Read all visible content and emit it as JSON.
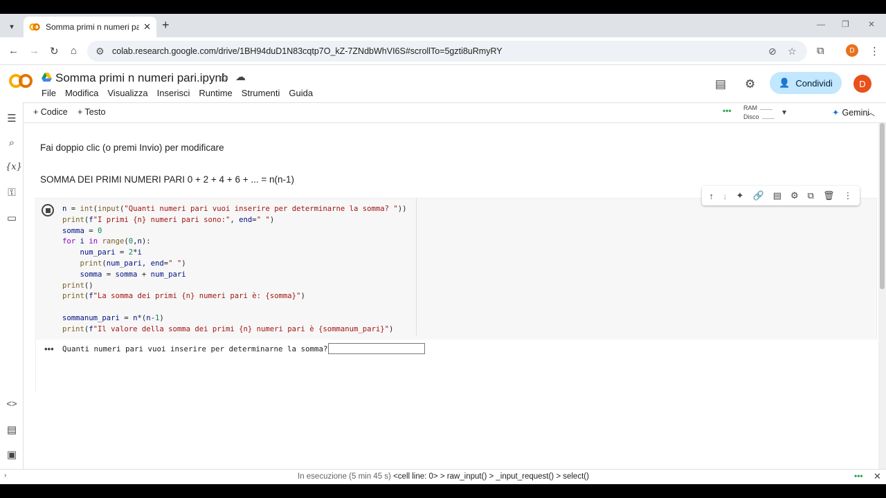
{
  "browser": {
    "tab_title": "Somma primi n numeri pari.ipynb",
    "new_tab": "+",
    "url": "colab.research.google.com/drive/1BH94duD1N83cqtp7O_kZ-7ZNdbWhVI6S#scrollTo=5gzti8uRmyRY",
    "profile_initial": "D"
  },
  "colab": {
    "logo": "CO",
    "notebook_title": "Somma primi n numeri pari.ipynb",
    "menu": [
      "File",
      "Modifica",
      "Visualizza",
      "Inserisci",
      "Runtime",
      "Strumenti",
      "Guida"
    ],
    "share_label": "Condividi",
    "avatar_initial": "D"
  },
  "toolbar": {
    "code_label": "Codice",
    "text_label": "Testo",
    "ram_label": "RAM",
    "disk_label": "Disco",
    "gemini_label": "Gemini"
  },
  "markdown": {
    "line1": "Fai doppio clic (o premi Invio) per modificare",
    "line2": "SOMMA DEI PRIMI NUMERI PARI 0 + 2 + 4 + 6 + ... = n(n-1)"
  },
  "code_lines": [
    "n = int(input(\"Quanti numeri pari vuoi inserire per determinarne la somma? \"))",
    "print(f\"I primi {n} numeri pari sono:\", end=\" \")",
    "somma = 0",
    "for i in range(0,n):",
    "    num_pari = 2*i",
    "    print(num_pari, end=\" \")",
    "    somma = somma + num_pari",
    "print()",
    "print(f\"La somma dei primi {n} numeri pari è: {somma}\")",
    "",
    "sommanum_pari = n*(n-1)",
    "print(f\"Il valore della somma dei primi {n} numeri pari è {sommanum_pari}\")"
  ],
  "output": {
    "dots": "•••",
    "prompt": "Quanti numeri pari vuoi inserire per determinarne la somma?",
    "input_value": ""
  },
  "status": {
    "running": "In esecuzione (5 min 45 s)",
    "trace": "<cell line: 0> > raw_input() > _input_request() > select()"
  },
  "colors": {
    "accent": "#1a73e8",
    "share_bg": "#c2e7ff",
    "avatar_bg": "#e8501c",
    "logo_orange": "#f9ab00"
  }
}
